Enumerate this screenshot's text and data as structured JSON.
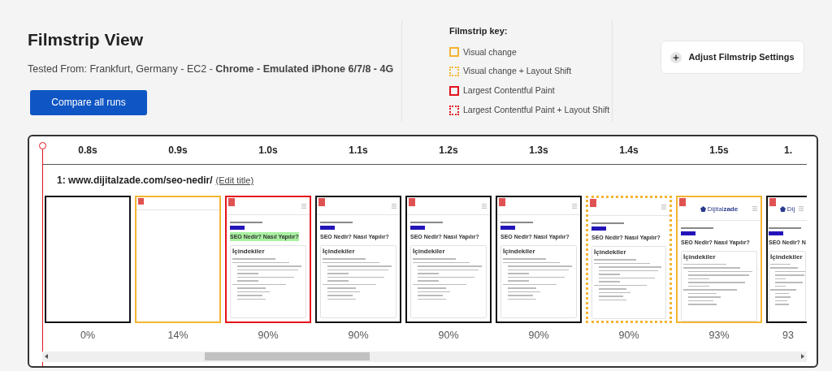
{
  "header": {
    "title": "Filmstrip View",
    "tested_from": "Tested From: Frankfurt, Germany - EC2 - **Chrome - Emulated iPhone 6/7/8 - 4G**",
    "compare_button": "Compare all runs"
  },
  "key": {
    "title": "Filmstrip key:",
    "items": [
      {
        "kind": "visual",
        "label": "Visual change"
      },
      {
        "kind": "visual_layout",
        "label": "Visual change + Layout Shift"
      },
      {
        "kind": "lcp",
        "label": "Largest Contentful Paint"
      },
      {
        "kind": "lcp_layout",
        "label": "Largest Contentful Paint + Layout Shift"
      }
    ]
  },
  "settings_button": "Adjust Filmstrip Settings",
  "filmstrip": {
    "run_title": "1: www.dijitalzade.com/seo-nedir/",
    "edit_link": "(Edit title)",
    "frames": [
      {
        "kind": "none",
        "time": "0.8s",
        "percent": "0%",
        "partial": false,
        "thumbnail": {
          "kind": "blank"
        }
      },
      {
        "kind": "visual",
        "time": "0.9s",
        "percent": "14%",
        "partial": false,
        "thumbnail": {
          "kind": "loading"
        }
      },
      {
        "kind": "lcp",
        "time": "1.0s",
        "percent": "90%",
        "partial": false,
        "thumbnail": {
          "kind": "page",
          "highlight": true,
          "heading": "SEO Nedir? Nasıl Yapılır?",
          "toc_title": "İçindekiler"
        }
      },
      {
        "kind": "none",
        "time": "1.1s",
        "percent": "90%",
        "partial": false,
        "thumbnail": {
          "kind": "page",
          "highlight": false,
          "heading": "SEO Nedir? Nasıl Yapılır?",
          "toc_title": "İçindekiler"
        }
      },
      {
        "kind": "none",
        "time": "1.2s",
        "percent": "90%",
        "partial": false,
        "thumbnail": {
          "kind": "page",
          "highlight": false,
          "heading": "SEO Nedir? Nasıl Yapılır?",
          "toc_title": "İçindekiler"
        }
      },
      {
        "kind": "none",
        "time": "1.3s",
        "percent": "90%",
        "partial": false,
        "thumbnail": {
          "kind": "page",
          "highlight": false,
          "heading": "SEO Nedir? Nasıl Yapılır?",
          "toc_title": "İçindekiler"
        }
      },
      {
        "kind": "visual_layout",
        "time": "1.4s",
        "percent": "90%",
        "partial": false,
        "thumbnail": {
          "kind": "page",
          "highlight": false,
          "heading": "SEO Nedir? Nasıl Yapılır?",
          "toc_title": "İçindekiler"
        }
      },
      {
        "kind": "visual",
        "time": "1.5s",
        "percent": "93%",
        "partial": false,
        "thumbnail": {
          "kind": "page",
          "highlight": false,
          "logo": "Dijital**zade**",
          "heading": "SEO Nedir? Nasıl Yapılır?",
          "toc_title": "İçindekiler"
        }
      },
      {
        "kind": "none",
        "time": "1.",
        "percent": "93",
        "partial": true,
        "thumbnail": {
          "kind": "page",
          "highlight": false,
          "logo": "Dij",
          "heading": "SEO Nedir? N",
          "toc_title": "İçindekiler"
        }
      }
    ]
  }
}
